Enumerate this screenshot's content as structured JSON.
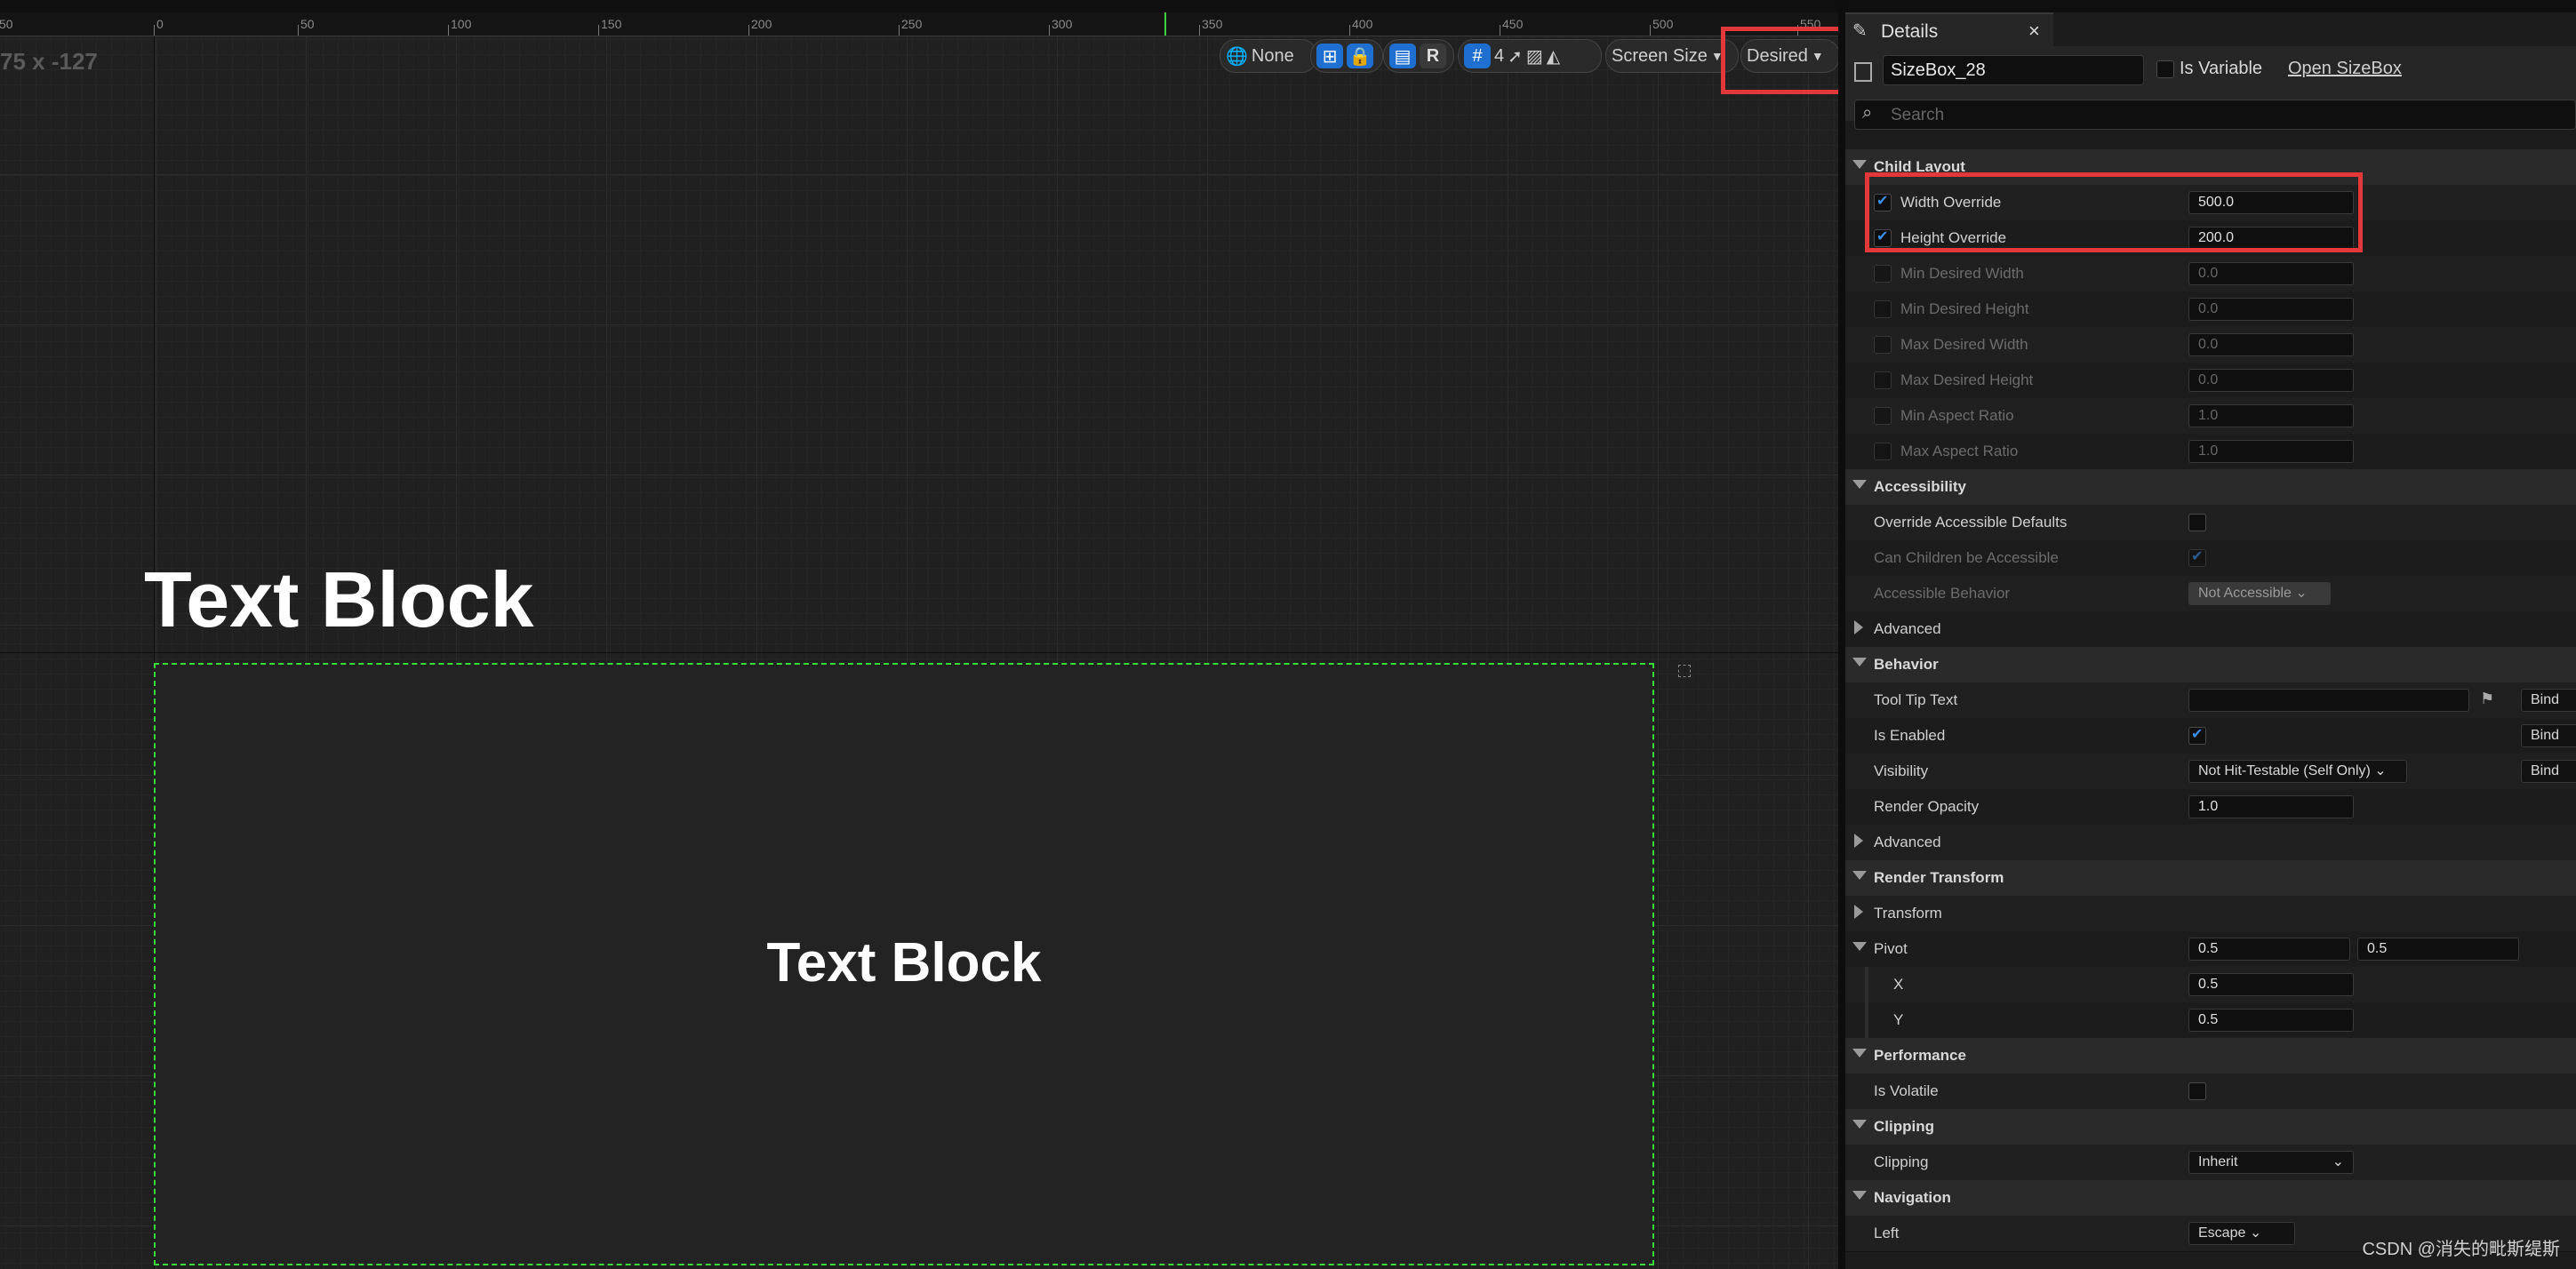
{
  "designer": {
    "coords": "75 x -127",
    "ruler_labels": [
      "50",
      "0",
      "50",
      "100",
      "150",
      "200",
      "250",
      "300",
      "350",
      "400",
      "450",
      "500",
      "550"
    ],
    "toolbar": {
      "none_label": "None",
      "r_label": "R",
      "grid_value": "4",
      "screen_size_label": "Screen Size",
      "desired_label": "Desired"
    },
    "canvas_text_top": "Text Block",
    "canvas_text_inner": "Text Block"
  },
  "details": {
    "tab_title": "Details",
    "close_glyph": "×",
    "widget_name": "SizeBox_28",
    "is_variable_label": "Is Variable",
    "open_link": "Open SizeBox",
    "search_placeholder": "Search",
    "sections": {
      "child_layout": {
        "title": "Child Layout",
        "width_override": {
          "label": "Width Override",
          "value": "500.0"
        },
        "height_override": {
          "label": "Height Override",
          "value": "200.0"
        },
        "min_desired_width": {
          "label": "Min Desired Width",
          "value": "0.0"
        },
        "min_desired_height": {
          "label": "Min Desired Height",
          "value": "0.0"
        },
        "max_desired_width": {
          "label": "Max Desired Width",
          "value": "0.0"
        },
        "max_desired_height": {
          "label": "Max Desired Height",
          "value": "0.0"
        },
        "min_aspect_ratio": {
          "label": "Min Aspect Ratio",
          "value": "1.0"
        },
        "max_aspect_ratio": {
          "label": "Max Aspect Ratio",
          "value": "1.0"
        }
      },
      "accessibility": {
        "title": "Accessibility",
        "override_defaults": "Override Accessible Defaults",
        "can_children": "Can Children be Accessible",
        "behavior_label": "Accessible Behavior",
        "behavior_value": "Not Accessible",
        "advanced": "Advanced"
      },
      "behavior": {
        "title": "Behavior",
        "tooltip": "Tool Tip Text",
        "is_enabled": "Is Enabled",
        "visibility": "Visibility",
        "visibility_value": "Not Hit-Testable (Self Only)",
        "render_opacity": "Render Opacity",
        "render_opacity_value": "1.0",
        "bind": "Bind",
        "advanced": "Advanced"
      },
      "render_transform": {
        "title": "Render Transform",
        "transform": "Transform",
        "pivot": "Pivot",
        "pivot_x_value": "0.5",
        "pivot_y_value": "0.5",
        "x_label": "X",
        "x_value": "0.5",
        "y_label": "Y",
        "y_value": "0.5"
      },
      "performance": {
        "title": "Performance",
        "is_volatile": "Is Volatile"
      },
      "clipping": {
        "title": "Clipping",
        "clipping": "Clipping",
        "clipping_value": "Inherit"
      },
      "navigation": {
        "title": "Navigation",
        "left": "Left",
        "left_value": "Escape"
      }
    },
    "footer": "CSDN @消失的毗斯缇斯"
  },
  "colors": {
    "highlight_red": "#e2383a",
    "selection_green": "#3adc3a",
    "accent_blue": "#1f6fd1"
  }
}
